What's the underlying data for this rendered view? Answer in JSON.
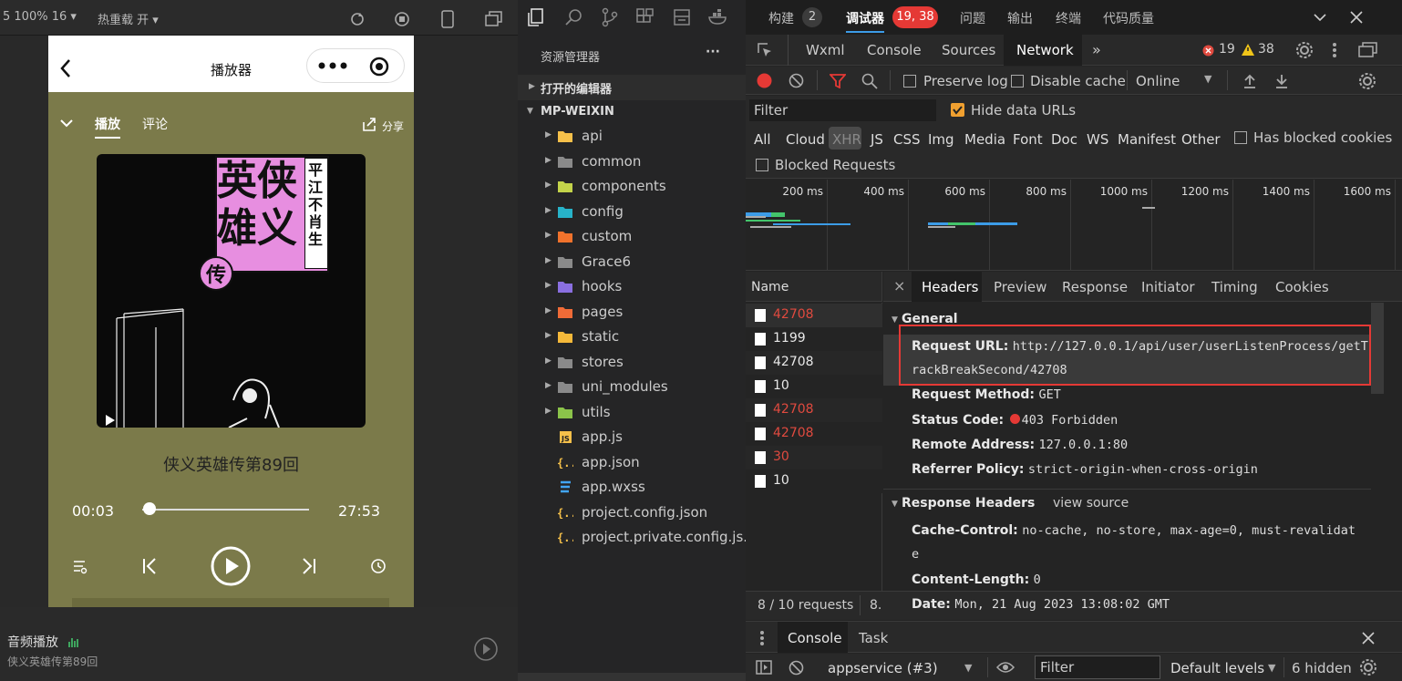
{
  "colors": {
    "accent_red": "#e53935",
    "link_blue": "#3c9ce7",
    "phone_bg": "#7b7a4a",
    "error": "#e04a3f",
    "warn": "#f0c419"
  },
  "simulator": {
    "toolbar": {
      "zoom": "5 100% 16 ▾",
      "hot_reload": "热重载 开 ▾"
    },
    "nav": {
      "title": "播放器"
    },
    "tabs": {
      "play": "播放",
      "comment": "评论",
      "share": "分享"
    },
    "cover": {
      "title_vertical_1": "侠义",
      "title_vertical_2": "英雄",
      "title_3": "传",
      "author": "平江不肖生"
    },
    "track_title": "侠义英雄传第89回",
    "time_current": "00:03",
    "time_total": "27:53",
    "progress": 0.02,
    "bottom": {
      "label": "音频播放",
      "subtitle": "侠义英雄传第89回"
    }
  },
  "explorer": {
    "title": "资源管理器",
    "more": "···",
    "open_editors": "打开的编辑器",
    "project": "MP-WEIXIN",
    "items": [
      {
        "label": "api",
        "icon": "folder-api-icon",
        "color": "#f5c04a",
        "type": "folder"
      },
      {
        "label": "common",
        "icon": "folder-icon",
        "color": "#8a8a8a",
        "type": "folder"
      },
      {
        "label": "components",
        "icon": "folder-components-icon",
        "color": "#c3d34a",
        "type": "folder"
      },
      {
        "label": "config",
        "icon": "folder-config-icon",
        "color": "#27b3c9",
        "type": "folder"
      },
      {
        "label": "custom",
        "icon": "folder-custom-icon",
        "color": "#f0722c",
        "type": "folder"
      },
      {
        "label": "Grace6",
        "icon": "folder-icon",
        "color": "#8a8a8a",
        "type": "folder"
      },
      {
        "label": "hooks",
        "icon": "folder-hooks-icon",
        "color": "#8a6fe0",
        "type": "folder"
      },
      {
        "label": "pages",
        "icon": "folder-pages-icon",
        "color": "#f06b37",
        "type": "folder"
      },
      {
        "label": "static",
        "icon": "folder-static-icon",
        "color": "#f5b93a",
        "type": "folder"
      },
      {
        "label": "stores",
        "icon": "folder-icon",
        "color": "#8a8a8a",
        "type": "folder"
      },
      {
        "label": "uni_modules",
        "icon": "folder-icon",
        "color": "#8a8a8a",
        "type": "folder"
      },
      {
        "label": "utils",
        "icon": "folder-utils-icon",
        "color": "#8bc34a",
        "type": "folder"
      },
      {
        "label": "app.js",
        "icon": "js-file-icon",
        "color": "#f5c04a",
        "type": "file"
      },
      {
        "label": "app.json",
        "icon": "json-file-icon",
        "color": "#f5c04a",
        "type": "file"
      },
      {
        "label": "app.wxss",
        "icon": "css-file-icon",
        "color": "#42a5f5",
        "type": "file"
      },
      {
        "label": "project.config.json",
        "icon": "json-file-icon",
        "color": "#f5c04a",
        "type": "file"
      },
      {
        "label": "project.private.config.js...",
        "icon": "json-file-icon",
        "color": "#f5c04a",
        "type": "file"
      }
    ]
  },
  "devtools": {
    "top_tabs": {
      "build": "构建",
      "build_badge": "2",
      "debugger": "调试器",
      "debugger_badge": "19, 38",
      "issues": "问题",
      "output": "输出",
      "terminal": "终端",
      "quality": "代码质量"
    },
    "panel_tabs": [
      "Wxml",
      "Console",
      "Sources",
      "Network"
    ],
    "active_panel": "Network",
    "more_panels": "»",
    "error_count": "19",
    "warn_count": "38",
    "toolbar": {
      "preserve_log": "Preserve log",
      "disable_cache": "Disable cache",
      "throttle": "Online"
    },
    "filter": {
      "placeholder": "Filter",
      "hide_data_urls": "Hide data URLs"
    },
    "types": [
      "All",
      "Cloud",
      "XHR",
      "JS",
      "CSS",
      "Img",
      "Media",
      "Font",
      "Doc",
      "WS",
      "Manifest",
      "Other"
    ],
    "active_type": "XHR",
    "has_blocked_cookies": "Has blocked cookies",
    "blocked_requests": "Blocked Requests",
    "timeline_ticks": [
      "200 ms",
      "400 ms",
      "600 ms",
      "800 ms",
      "1000 ms",
      "1200 ms",
      "1400 ms",
      "1600 ms"
    ],
    "name_header": "Name",
    "requests": [
      {
        "name": "42708",
        "error": true
      },
      {
        "name": "1199",
        "error": false
      },
      {
        "name": "42708",
        "error": false
      },
      {
        "name": "10",
        "error": false
      },
      {
        "name": "42708",
        "error": true
      },
      {
        "name": "42708",
        "error": true
      },
      {
        "name": "30",
        "error": true
      },
      {
        "name": "10",
        "error": false
      }
    ],
    "footer": {
      "requests": "8 / 10 requests",
      "transferred": "8."
    },
    "detail_close": "×",
    "detail_tabs": [
      "Headers",
      "Preview",
      "Response",
      "Initiator",
      "Timing",
      "Cookies"
    ],
    "general_title": "General",
    "general": {
      "url_label": "Request URL:",
      "url_value_1": "http://127.0.0.1/api/user/userListenProcess/getT",
      "url_value_2": "rackBreakSecond/42708",
      "method_label": "Request Method:",
      "method_value": "GET",
      "status_label": "Status Code:",
      "status_value": "403 Forbidden",
      "remote_label": "Remote Address:",
      "remote_value": "127.0.0.1:80",
      "referrer_label": "Referrer Policy:",
      "referrer_value": "strict-origin-when-cross-origin"
    },
    "response_headers_title": "Response Headers",
    "view_source": "view source",
    "response_headers": {
      "cache_label": "Cache-Control:",
      "cache_value_1": "no-cache, no-store, max-age=0, must-revalidat",
      "cache_value_2": "e",
      "length_label": "Content-Length:",
      "length_value": "0",
      "date_label": "Date:",
      "date_value": "Mon, 21 Aug 2023 13:08:02 GMT"
    },
    "drawer": {
      "console": "Console",
      "task": "Task",
      "context": "appservice (#3)",
      "filter_placeholder": "Filter",
      "levels": "Default levels",
      "hidden": "6 hidden"
    }
  }
}
